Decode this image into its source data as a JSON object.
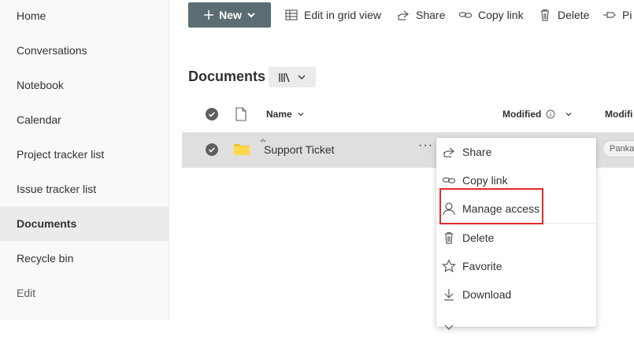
{
  "sidebar": {
    "items": [
      {
        "label": "Home"
      },
      {
        "label": "Conversations"
      },
      {
        "label": "Notebook"
      },
      {
        "label": "Calendar"
      },
      {
        "label": "Project tracker list"
      },
      {
        "label": "Issue tracker list"
      },
      {
        "label": "Documents",
        "active": true
      },
      {
        "label": "Recycle bin"
      },
      {
        "label": "Edit"
      }
    ]
  },
  "toolbar": {
    "new_label": "New",
    "edit_grid_label": "Edit in grid view",
    "share_label": "Share",
    "copy_link_label": "Copy link",
    "delete_label": "Delete",
    "pin_label": "Pi"
  },
  "library": {
    "title": "Documents"
  },
  "columns": {
    "name": "Name",
    "modified": "Modified",
    "modified_by": "Modifi"
  },
  "rows": [
    {
      "name": "Support Ticket",
      "modified_by": "Panka"
    }
  ],
  "context_menu": {
    "items": [
      {
        "label": "Share",
        "icon": "share-icon"
      },
      {
        "label": "Copy link",
        "icon": "link-icon"
      },
      {
        "label": "Manage access",
        "icon": "person-icon"
      },
      {
        "label": "Delete",
        "icon": "trash-icon"
      },
      {
        "label": "Favorite",
        "icon": "star-icon"
      },
      {
        "label": "Download",
        "icon": "download-icon"
      }
    ],
    "highlighted": "Manage access"
  },
  "colors": {
    "new_button": "#5b6d73",
    "highlight": "#e32b2b",
    "row_selected": "#e1dfdd",
    "folder": "#f2c230"
  }
}
